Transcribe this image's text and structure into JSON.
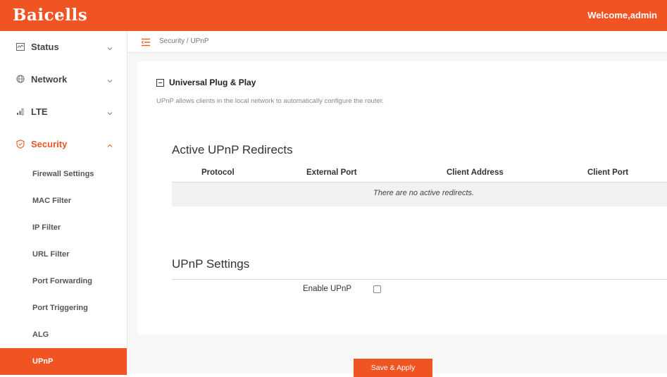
{
  "header": {
    "logo_text": "Baicells",
    "welcome_text": "Welcome,admin",
    "brand_color": "#f05423"
  },
  "sidebar": {
    "items": [
      {
        "label": "Status",
        "icon": "status-monitor-icon"
      },
      {
        "label": "Network",
        "icon": "globe-icon"
      },
      {
        "label": "LTE",
        "icon": "signal-bars-icon"
      },
      {
        "label": "Security",
        "icon": "shield-icon"
      }
    ],
    "security_subitems": [
      {
        "label": "Firewall Settings"
      },
      {
        "label": "MAC Filter"
      },
      {
        "label": "IP Filter"
      },
      {
        "label": "URL Filter"
      },
      {
        "label": "Port Forwarding"
      },
      {
        "label": "Port Triggering"
      },
      {
        "label": "ALG"
      },
      {
        "label": "UPnP"
      }
    ],
    "active_subitem": "UPnP"
  },
  "breadcrumb": {
    "text": "Security / UPnP"
  },
  "main": {
    "section_title": "Universal Plug & Play",
    "description": "UPnP allows clients in the local network to automatically configure the router.",
    "redirects": {
      "title": "Active UPnP Redirects",
      "columns": [
        "Protocol",
        "External Port",
        "Client Address",
        "Client Port"
      ],
      "empty_message": "There are no active redirects."
    },
    "settings": {
      "title": "UPnP Settings",
      "enable_label": "Enable UPnP",
      "enable_checked": false
    },
    "save_button": "Save & Apply"
  }
}
